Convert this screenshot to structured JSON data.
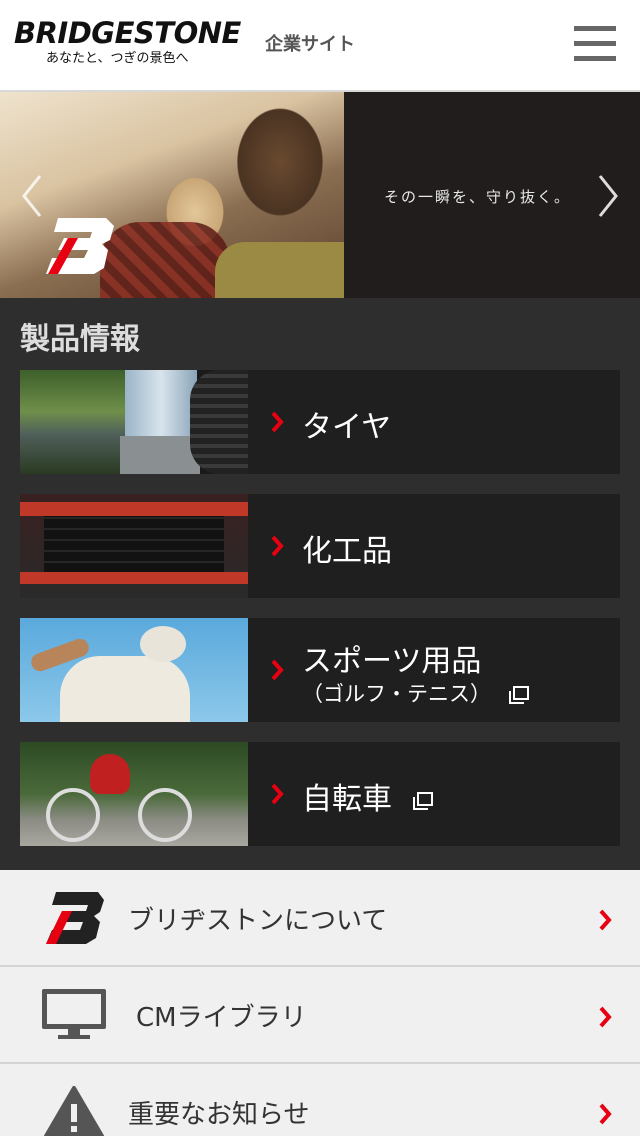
{
  "header": {
    "logo_text": "BRIDGESTONE",
    "logo_tagline": "あなたと、つぎの景色へ",
    "site_label": "企業サイト",
    "menu_icon": "hamburger-menu-icon"
  },
  "hero": {
    "tagline": "その一瞬を、守り抜く。",
    "prev_icon": "chevron-left-icon",
    "next_icon": "chevron-right-icon"
  },
  "products": {
    "title": "製品情報",
    "items": [
      {
        "label": "タイヤ",
        "sub": "",
        "external": false
      },
      {
        "label": "化工品",
        "sub": "",
        "external": false
      },
      {
        "label": "スポーツ用品",
        "sub": "（ゴルフ・テニス）",
        "external": true
      },
      {
        "label": "自転車",
        "sub": "",
        "external": true
      }
    ]
  },
  "menu": {
    "items": [
      {
        "label": "ブリヂストンについて",
        "icon": "bridgestone-b-icon"
      },
      {
        "label": "CMライブラリ",
        "icon": "monitor-icon"
      },
      {
        "label": "重要なお知らせ",
        "icon": "warning-icon"
      }
    ]
  },
  "colors": {
    "accent_red": "#e60012",
    "header_bg": "#ffffff",
    "products_bg": "#2e2e2e",
    "menu_bg": "#f0f0f0"
  }
}
